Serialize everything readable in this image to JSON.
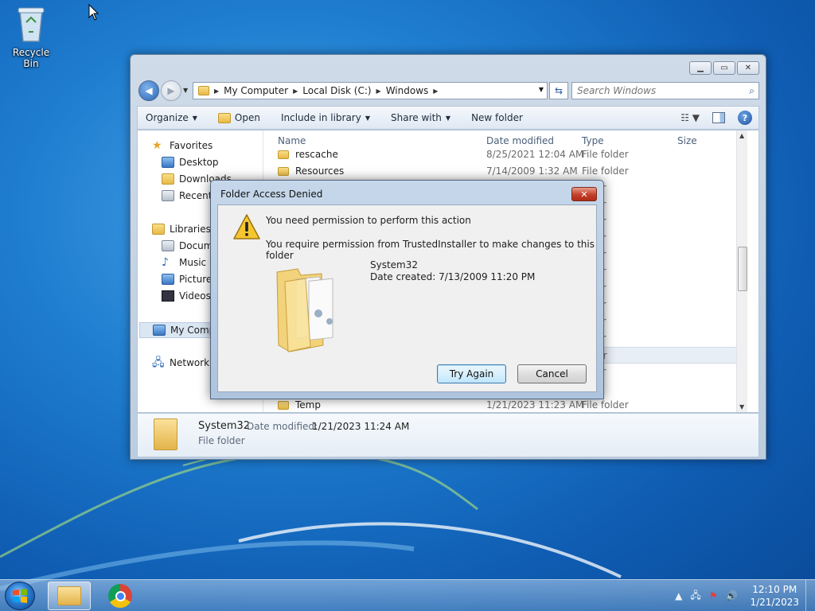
{
  "desktop": {
    "recycle_bin_label": "Recycle Bin"
  },
  "explorer": {
    "address": {
      "crumbs": [
        "My Computer",
        "Local Disk (C:)",
        "Windows"
      ]
    },
    "search_placeholder": "Search Windows",
    "toolbar": {
      "organize": "Organize",
      "open": "Open",
      "include_in_library": "Include in library",
      "share_with": "Share with",
      "new_folder": "New folder"
    },
    "nav": {
      "favorites": "Favorites",
      "desktop": "Desktop",
      "downloads": "Downloads",
      "recent": "Recent P",
      "libraries": "Libraries",
      "documents": "Docume",
      "music": "Music",
      "pictures": "Pictures",
      "videos": "Videos",
      "my_computer": "My Comp",
      "network": "Network"
    },
    "columns": {
      "name": "Name",
      "date_modified": "Date modified",
      "type": "Type",
      "size": "Size"
    },
    "files": [
      {
        "name": "rescache",
        "date": "8/25/2021 12:04 AM",
        "type": "File folder"
      },
      {
        "name": "Resources",
        "date": "7/14/2009 1:32 AM",
        "type": "File folder"
      },
      {
        "name": "",
        "date": "",
        "type": "older"
      },
      {
        "name": "",
        "date": "",
        "type": "older"
      },
      {
        "name": "",
        "date": "",
        "type": "older"
      },
      {
        "name": "",
        "date": "",
        "type": "older"
      },
      {
        "name": "",
        "date": "",
        "type": "older"
      },
      {
        "name": "",
        "date": "",
        "type": "older"
      },
      {
        "name": "",
        "date": "",
        "type": "older"
      },
      {
        "name": "",
        "date": "",
        "type": "older"
      },
      {
        "name": "",
        "date": "",
        "type": "older"
      },
      {
        "name": "",
        "date": "",
        "type": "older"
      },
      {
        "name": "",
        "date": "",
        "type": "older"
      },
      {
        "name": "",
        "date": "",
        "type": "older"
      },
      {
        "name": "Temp",
        "date": "1/21/2023 11:23 AM",
        "type": "File folder"
      }
    ],
    "details": {
      "name": "System32",
      "modified_label": "Date modified:",
      "modified": "1/21/2023 11:24 AM",
      "type": "File folder"
    }
  },
  "dialog": {
    "title": "Folder Access Denied",
    "message1": "You need permission to perform this action",
    "message2": "You require permission from TrustedInstaller to make changes to this folder",
    "folder_name": "System32",
    "folder_date": "Date created: 7/13/2009 11:20 PM",
    "try_again": "Try Again",
    "cancel": "Cancel"
  },
  "taskbar": {
    "time": "12:10 PM",
    "date": "1/21/2023"
  }
}
